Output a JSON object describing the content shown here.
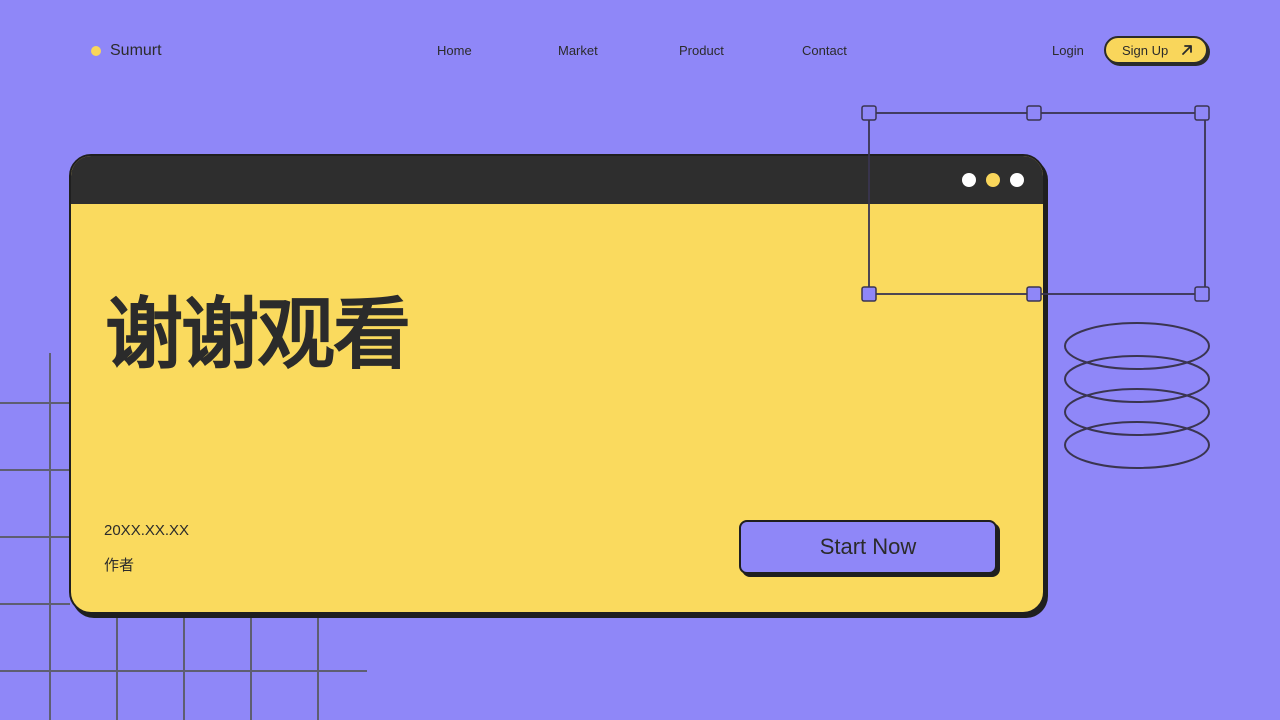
{
  "header": {
    "brand": "Sumurt",
    "nav": [
      {
        "label": "Home"
      },
      {
        "label": "Market"
      },
      {
        "label": "Product"
      },
      {
        "label": "Contact"
      }
    ],
    "login": "Login",
    "signup": "Sign Up"
  },
  "window": {
    "title": "谢谢观看",
    "date": "20XX.XX.XX",
    "author": "作者",
    "cta": "Start Now"
  },
  "colors": {
    "background": "#8F87F8",
    "accent_yellow": "#F9D65B",
    "dark": "#2B2B2B"
  }
}
